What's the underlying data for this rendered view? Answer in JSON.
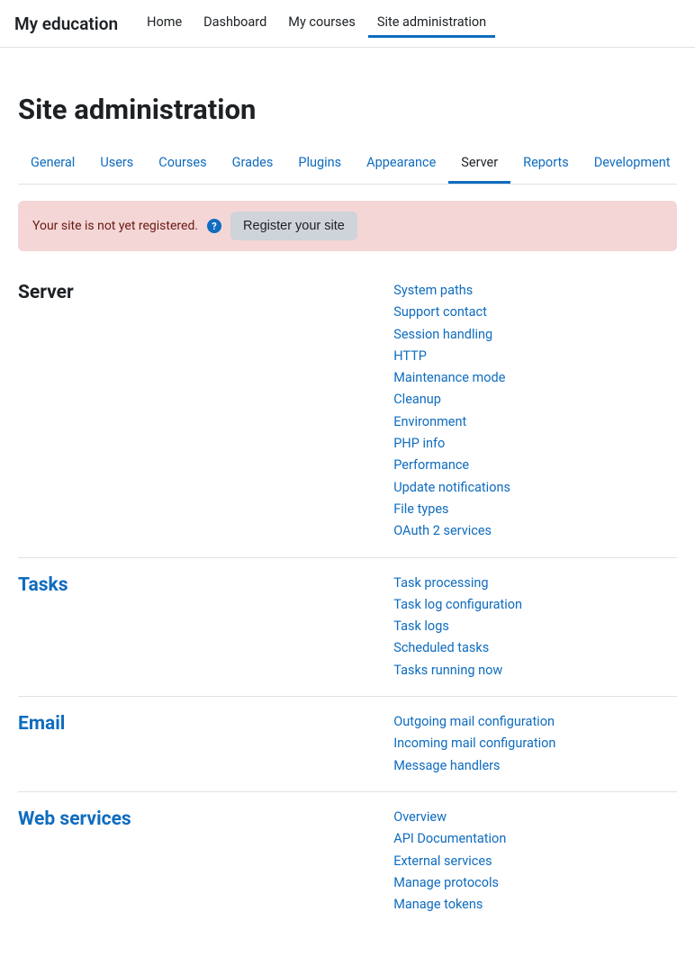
{
  "brand": "My education",
  "topnav": [
    {
      "label": "Home",
      "active": false
    },
    {
      "label": "Dashboard",
      "active": false
    },
    {
      "label": "My courses",
      "active": false
    },
    {
      "label": "Site administration",
      "active": true
    }
  ],
  "pageTitle": "Site administration",
  "tabs": [
    {
      "label": "General",
      "active": false
    },
    {
      "label": "Users",
      "active": false
    },
    {
      "label": "Courses",
      "active": false
    },
    {
      "label": "Grades",
      "active": false
    },
    {
      "label": "Plugins",
      "active": false
    },
    {
      "label": "Appearance",
      "active": false
    },
    {
      "label": "Server",
      "active": true
    },
    {
      "label": "Reports",
      "active": false
    },
    {
      "label": "Development",
      "active": false
    }
  ],
  "alert": {
    "text": "Your site is not yet registered.",
    "help": "?",
    "button": "Register your site"
  },
  "sections": [
    {
      "title": "Server",
      "isLink": false,
      "items": [
        "System paths",
        "Support contact",
        "Session handling",
        "HTTP",
        "Maintenance mode",
        "Cleanup",
        "Environment",
        "PHP info",
        "Performance",
        "Update notifications",
        "File types",
        "OAuth 2 services"
      ]
    },
    {
      "title": "Tasks",
      "isLink": true,
      "items": [
        "Task processing",
        "Task log configuration",
        "Task logs",
        "Scheduled tasks",
        "Tasks running now"
      ]
    },
    {
      "title": "Email",
      "isLink": true,
      "items": [
        "Outgoing mail configuration",
        "Incoming mail configuration",
        "Message handlers"
      ]
    },
    {
      "title": "Web services",
      "isLink": true,
      "items": [
        "Overview",
        "API Documentation",
        "External services",
        "Manage protocols",
        "Manage tokens"
      ]
    }
  ]
}
